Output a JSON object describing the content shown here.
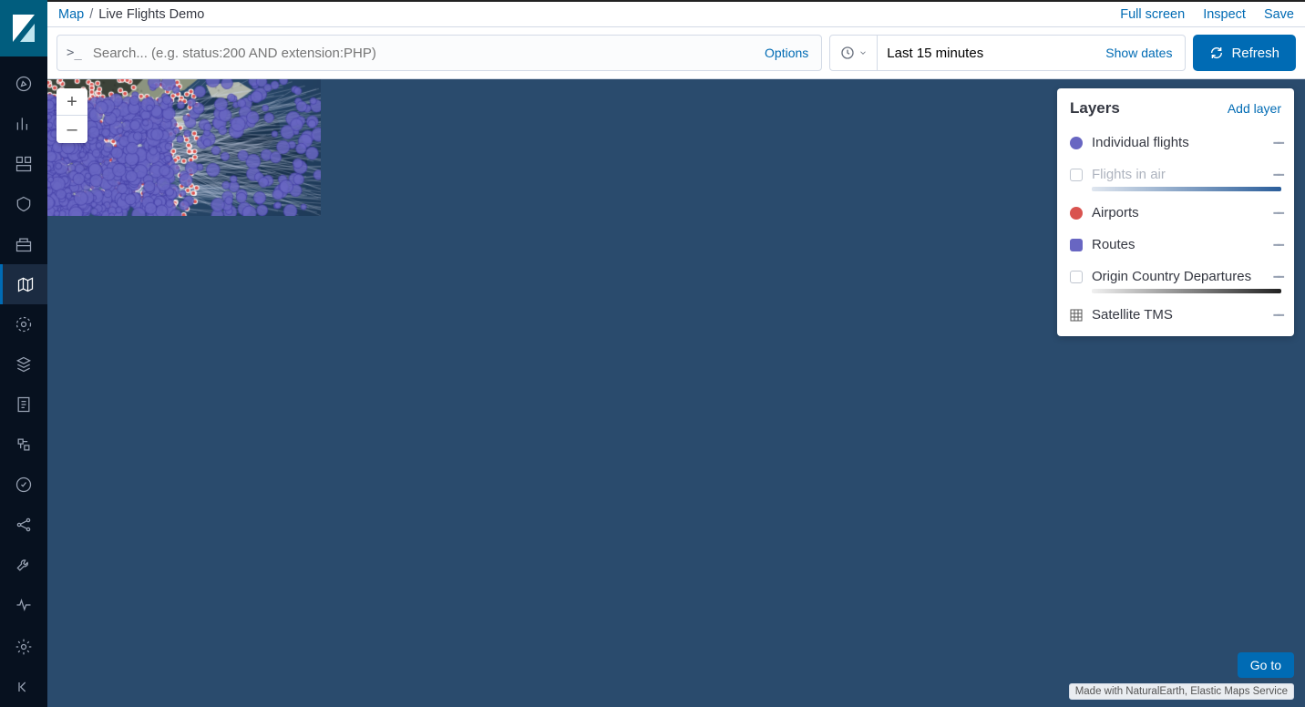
{
  "breadcrumb": {
    "root": "Map",
    "current": "Live Flights Demo"
  },
  "topActions": {
    "fullscreen": "Full screen",
    "inspect": "Inspect",
    "save": "Save"
  },
  "search": {
    "placeholder": "Search... (e.g. status:200 AND extension:PHP)",
    "options": "Options"
  },
  "time": {
    "value": "Last 15 minutes",
    "showDates": "Show dates"
  },
  "refresh": "Refresh",
  "zoom": {
    "in": "+",
    "out": "–"
  },
  "layersPanel": {
    "title": "Layers",
    "addLayer": "Add layer",
    "items": [
      {
        "label": "Individual flights",
        "swatch": "#6866c2",
        "shape": "circle"
      },
      {
        "label": "Flights in air",
        "swatch": "box",
        "shape": "box",
        "muted": true,
        "gradient": "linear-gradient(90deg,#dfe6ef,#2a5d9a)"
      },
      {
        "label": "Airports",
        "swatch": "#d9534f",
        "shape": "circle"
      },
      {
        "label": "Routes",
        "swatch": "#6866c2",
        "shape": "sq"
      },
      {
        "label": "Origin Country Departures",
        "swatch": "box",
        "shape": "box",
        "gradient": "linear-gradient(90deg,#f0f0f0,#222)"
      },
      {
        "label": "Satellite TMS",
        "swatch": "grid",
        "shape": "grid"
      }
    ]
  },
  "goto": "Go to",
  "attribution": "Made with NaturalEarth, Elastic Maps Service",
  "sidebarIcons": [
    "compass",
    "bar-chart",
    "dashboard",
    "shield",
    "building",
    "layers",
    "graph",
    "package",
    "clipboard",
    "pipeline",
    "target",
    "share",
    "wrench",
    "heartbeat",
    "gear",
    "collapse"
  ],
  "activeSidebar": "layers",
  "colors": {
    "flight": "#6866c2",
    "airport": "#d9534f",
    "route": "rgba(210,220,240,0.25)",
    "land": "#9fa79a",
    "landDark": "#3a4036"
  }
}
